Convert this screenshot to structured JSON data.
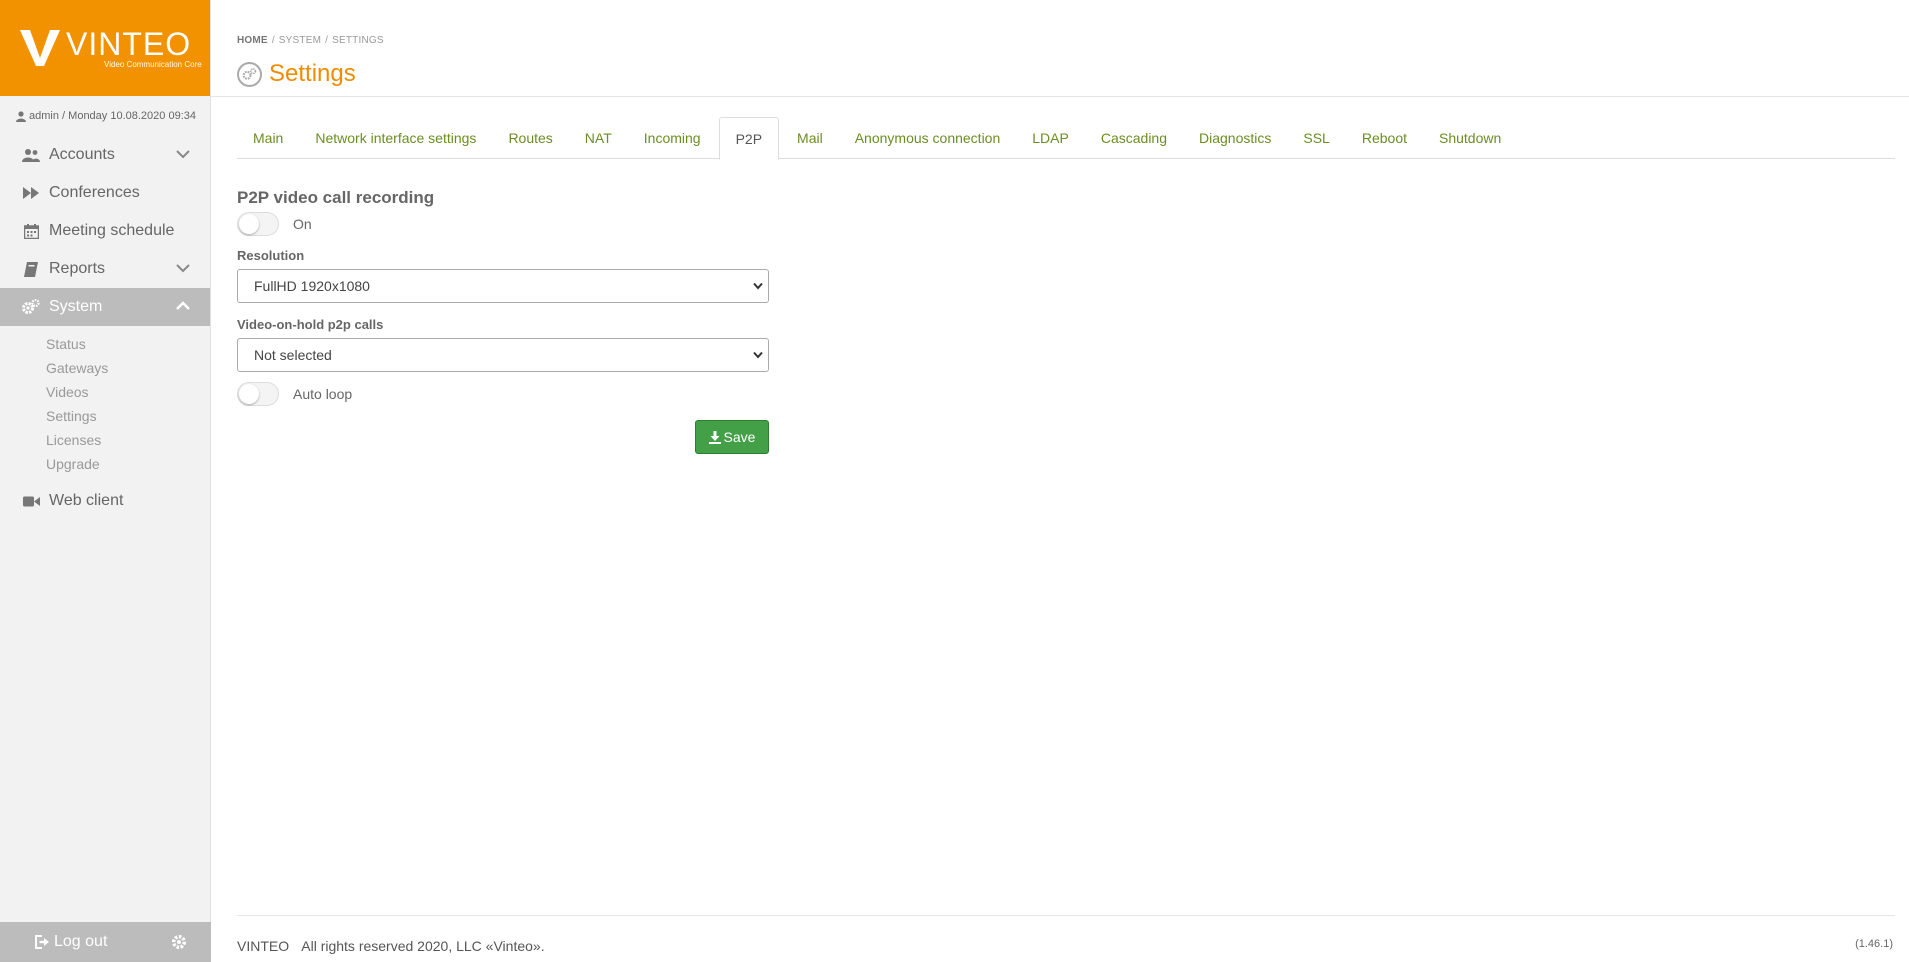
{
  "brand": {
    "name": "VINTEO",
    "tagline": "Video Communication Core"
  },
  "user_line": "admin / Monday 10.08.2020 09:34",
  "sidebar": {
    "items": [
      {
        "label": "Accounts",
        "icon": "users-icon",
        "has_chevron": true
      },
      {
        "label": "Conferences",
        "icon": "fast-forward-icon"
      },
      {
        "label": "Meeting schedule",
        "icon": "calendar-icon"
      },
      {
        "label": "Reports",
        "icon": "book-icon",
        "has_chevron": true
      },
      {
        "label": "System",
        "icon": "cogs-icon",
        "active": true,
        "expanded": true
      },
      {
        "label": "Web client",
        "icon": "video-camera-icon"
      }
    ],
    "system_subitems": [
      "Status",
      "Gateways",
      "Videos",
      "Settings",
      "Licenses",
      "Upgrade"
    ],
    "logout_label": "Log out"
  },
  "breadcrumb": [
    "HOME",
    "SYSTEM",
    "SETTINGS"
  ],
  "page_title": "Settings",
  "tabs": [
    "Main",
    "Network interface settings",
    "Routes",
    "NAT",
    "Incoming",
    "P2P",
    "Mail",
    "Anonymous connection",
    "LDAP",
    "Cascading",
    "Diagnostics",
    "SSL",
    "Reboot",
    "Shutdown"
  ],
  "active_tab": "P2P",
  "form": {
    "section_title": "P2P video call recording",
    "recording_toggle_label": "On",
    "recording_enabled": false,
    "resolution_label": "Resolution",
    "resolution_value": "FullHD 1920x1080",
    "hold_label": "Video-on-hold p2p calls",
    "hold_value": "Not selected",
    "autoloop_label": "Auto loop",
    "autoloop_enabled": false,
    "save_label": "Save"
  },
  "footer": {
    "brand": "VINTEO",
    "copyright": "All rights reserved 2020, LLC «Vinteo».",
    "version": "(1.46.1)"
  },
  "colors": {
    "accent": "#f39200",
    "title": "#f08c00",
    "tab_link": "#6b8e23",
    "save": "#43a047",
    "sidebar_active": "#bcbcbc"
  }
}
